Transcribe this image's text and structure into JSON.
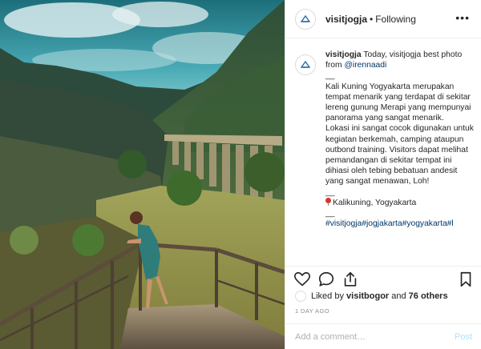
{
  "post": {
    "username": "visitjogja",
    "separator": "•",
    "follow_status": "Following",
    "more_label": "•••"
  },
  "caption": {
    "username": "visitjogja",
    "intro": " Today, visitjogja best photo from ",
    "mention": "@irennaadi",
    "dash": "__",
    "paragraph1": "Kali Kuning Yogyakarta merupakan tempat menarik yang terdapat di sekitar lereng gunung Merapi yang mempunyai panorama yang sangat menarik.",
    "paragraph2": "Lokasi ini sangat cocok digunakan untuk kegiatan berkemah, camping ataupun outbond training. Visitors dapat melihat pemandangan di sekitar tempat ini dihiasi oleh tebing bebatuan andesit yang sangat menawan, Loh!",
    "location": "Kalikuning, Yogyakarta",
    "hashtags": "#visitjogja#jogjakarta#yogyakarta#l"
  },
  "actions": {
    "icons": [
      "heart-icon",
      "comment-icon",
      "share-icon",
      "bookmark-icon"
    ]
  },
  "likes": {
    "prefix": "Liked by ",
    "user": "visitbogor",
    "middle": " and ",
    "others": "76 others"
  },
  "timestamp": "1 DAY AGO",
  "comment": {
    "placeholder": "Add a comment…",
    "post_label": "Post"
  },
  "colors": {
    "link": "#003569",
    "post_disabled": "#b2dffc",
    "muted": "#8e8e8e"
  }
}
